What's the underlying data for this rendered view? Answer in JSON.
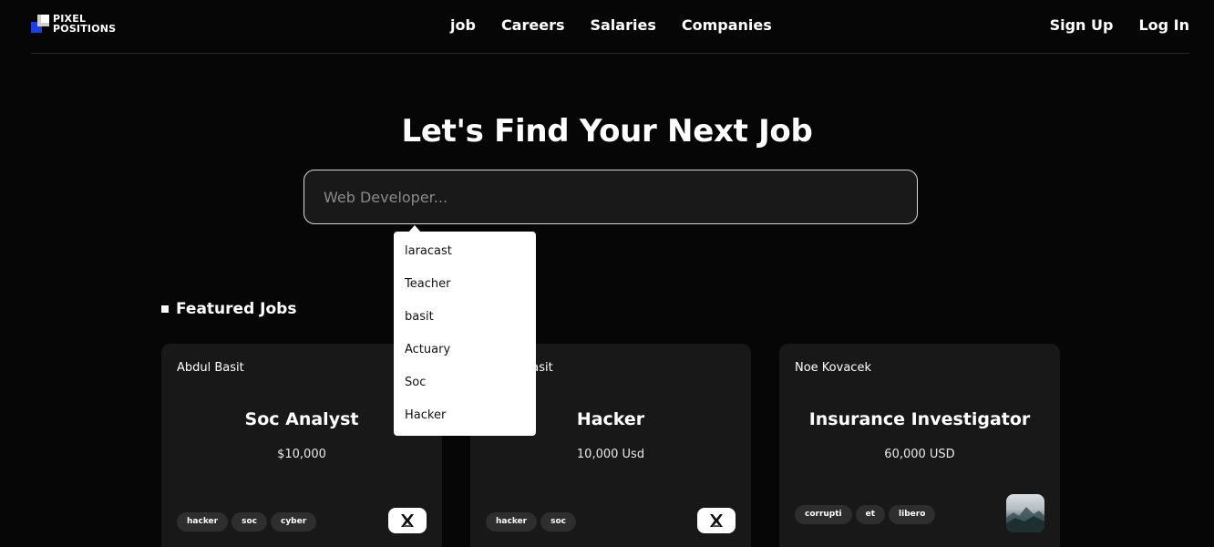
{
  "brand": {
    "line1": "PIXEL",
    "line2": "POSITIONS"
  },
  "nav": {
    "links": [
      "job",
      "Careers",
      "Salaries",
      "Companies"
    ],
    "signup": "Sign Up",
    "login": "Log In"
  },
  "hero": {
    "title": "Let's Find Your Next Job",
    "search_placeholder": "Web Developer..."
  },
  "suggestions": [
    "laracast",
    "Teacher",
    "basit",
    "Actuary",
    "Soc",
    "Hacker"
  ],
  "featured": {
    "heading": "Featured Jobs",
    "jobs": [
      {
        "employer": "Abdul Basit",
        "title": "Soc Analyst",
        "salary": "$10,000",
        "tags": [
          "hacker",
          "soc",
          "cyber"
        ],
        "logo": "x-logo-icon"
      },
      {
        "employer": "Abdul Basit",
        "title": "Hacker",
        "salary": "10,000 Usd",
        "tags": [
          "hacker",
          "soc"
        ],
        "logo": "x-logo-icon"
      },
      {
        "employer": "Noe Kovacek",
        "title": "Insurance Investigator",
        "salary": "60,000 USD",
        "tags": [
          "corrupti",
          "et",
          "libero"
        ],
        "logo": "mountain-photo"
      }
    ]
  },
  "colors": {
    "background": "#060606",
    "card": "#181818",
    "tag": "#2e2e2e",
    "brand_blue": "#1d3fe0"
  }
}
